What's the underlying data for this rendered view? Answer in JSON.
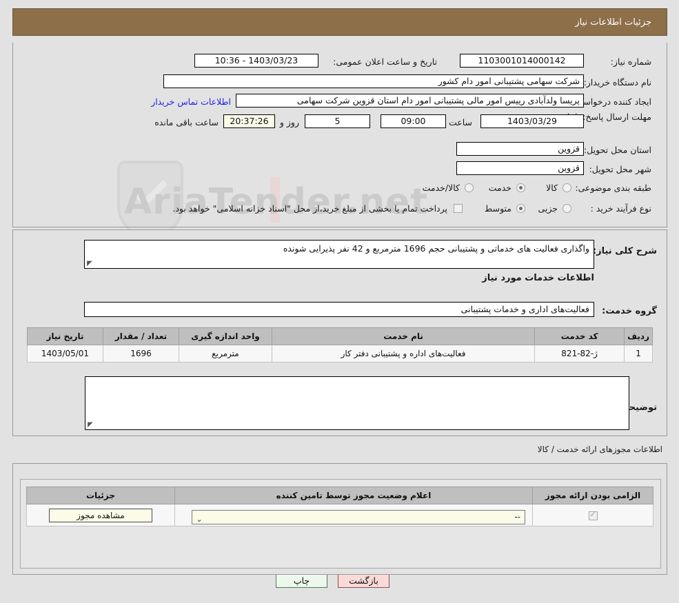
{
  "header": {
    "title": "جزئیات اطلاعات نیاز"
  },
  "watermark": {
    "text": "AriaTender.net"
  },
  "summary": {
    "need_number_label": "شماره نیاز:",
    "need_number_value": "1103001014000142",
    "announce_label": "تاریخ و ساعت اعلان عمومی:",
    "announce_value": "1403/03/23 - 10:36",
    "buyer_org_label": "نام دستگاه خریدار:",
    "buyer_org_value": "شرکت سهامی پشتیبانی امور دام کشور",
    "creator_label": "ایجاد کننده درخواست:",
    "creator_value": "پریسا ولدآبادی رییس امور مالی پشتیبانی امور دام استان قزوین شرکت سهامی",
    "contact_link": "اطلاعات تماس خریدار",
    "deadline_label": "مهلت ارسال پاسخ: تا تاریخ:",
    "deadline_date": "1403/03/29",
    "time_label": "ساعت",
    "deadline_time": "09:00",
    "days_value": "5",
    "days_label": "روز و",
    "countdown_value": "20:37:26",
    "countdown_label": "ساعت باقی مانده",
    "province_label": "استان محل تحویل:",
    "province_value": "قزوین",
    "city_label": "شهر محل تحویل:",
    "city_value": "قزوین",
    "category_label": "طبقه بندی موضوعی:",
    "category_options": [
      "کالا",
      "خدمت",
      "کالا/خدمت"
    ],
    "category_selected": "خدمت",
    "process_label": "نوع فرآیند خرید :",
    "process_options": [
      "جزیی",
      "متوسط"
    ],
    "process_selected": "متوسط",
    "treasury_note": "پرداخت تمام یا بخشی از مبلغ خرید،از محل \"اسناد خزانه اسلامی\" خواهد بود."
  },
  "need": {
    "description_label": "شرح کلی نیاز:",
    "description_value": "واگذاری فعالیت های خدماتی و پشتیبانی حجم 1696 مترمربع و 42 نفر پذیرایی شونده",
    "services_heading": "اطلاعات خدمات مورد نیاز",
    "service_group_label": "گروه خدمت:",
    "service_group_value": "فعالیت‌های اداری و خدمات پشتیبانی",
    "buyer_notes_label": "توضیحات خریدار:",
    "buyer_notes_value": ""
  },
  "service_table": {
    "columns": [
      "ردیف",
      "کد خدمت",
      "نام خدمت",
      "واحد اندازه گیری",
      "تعداد / مقدار",
      "تاریخ نیاز"
    ],
    "rows": [
      {
        "row": "1",
        "code": "ژ-82-821",
        "name": "فعالیت‌های اداره و پشتیبانی دفتر کار",
        "unit": "مترمربع",
        "quantity": "1696",
        "need_date": "1403/05/01"
      }
    ]
  },
  "licenses": {
    "section_title": "اطلاعات مجوزهای ارائه خدمت / کالا",
    "columns": [
      "الزامی بودن ارائه مجوز",
      "اعلام وضعیت مجوز توسط تامین کننده",
      "جزئیات"
    ],
    "rows": [
      {
        "required_checked": true,
        "status_value": "--",
        "details_button": "مشاهده مجوز"
      }
    ]
  },
  "footer": {
    "print_label": "چاپ",
    "back_label": "بازگشت"
  },
  "colors": {
    "header_bg": "#8d6f4a",
    "link": "#1f22e6",
    "print_bg": "#eef7ee",
    "back_bg": "#fad9d9",
    "table_header_bg": "#bfbfbf"
  }
}
